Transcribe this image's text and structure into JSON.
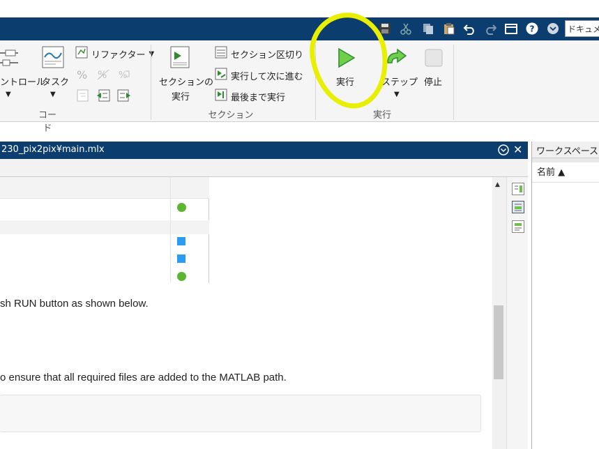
{
  "quick_access": {
    "icons": [
      "save-icon",
      "cut-icon",
      "copy-icon",
      "paste-icon",
      "undo-icon",
      "redo-icon",
      "window-icon",
      "help-icon",
      "options-icon"
    ],
    "search_placeholder": "ドキュメ"
  },
  "ribbon": {
    "control_label": "ントロール",
    "task_label": "タスク",
    "refactor_label": "リファクター",
    "code_group": "コード",
    "run_section_label_line1": "セクションの",
    "run_section_label_line2": "実行",
    "section_break": "セクション区切り",
    "run_and_advance": "実行して次に進む",
    "run_to_end": "最後まで実行",
    "section_group": "セクション",
    "run_label": "実行",
    "step_label": "ステップ",
    "stop_label": "停止",
    "run_group": "実行"
  },
  "editor": {
    "title": "230_pix2pix¥main.mlx",
    "line1": "sh RUN button as shown below.",
    "line2": "o ensure that all required files are added to the MATLAB path."
  },
  "workspace": {
    "title": "ワークスペース",
    "name_column": "名前 ▲"
  },
  "colors": {
    "title_bar": "#0b3d6e",
    "highlight": "#e9ef00",
    "status_green": "#5cb531",
    "status_blue": "#2b9cf2"
  }
}
